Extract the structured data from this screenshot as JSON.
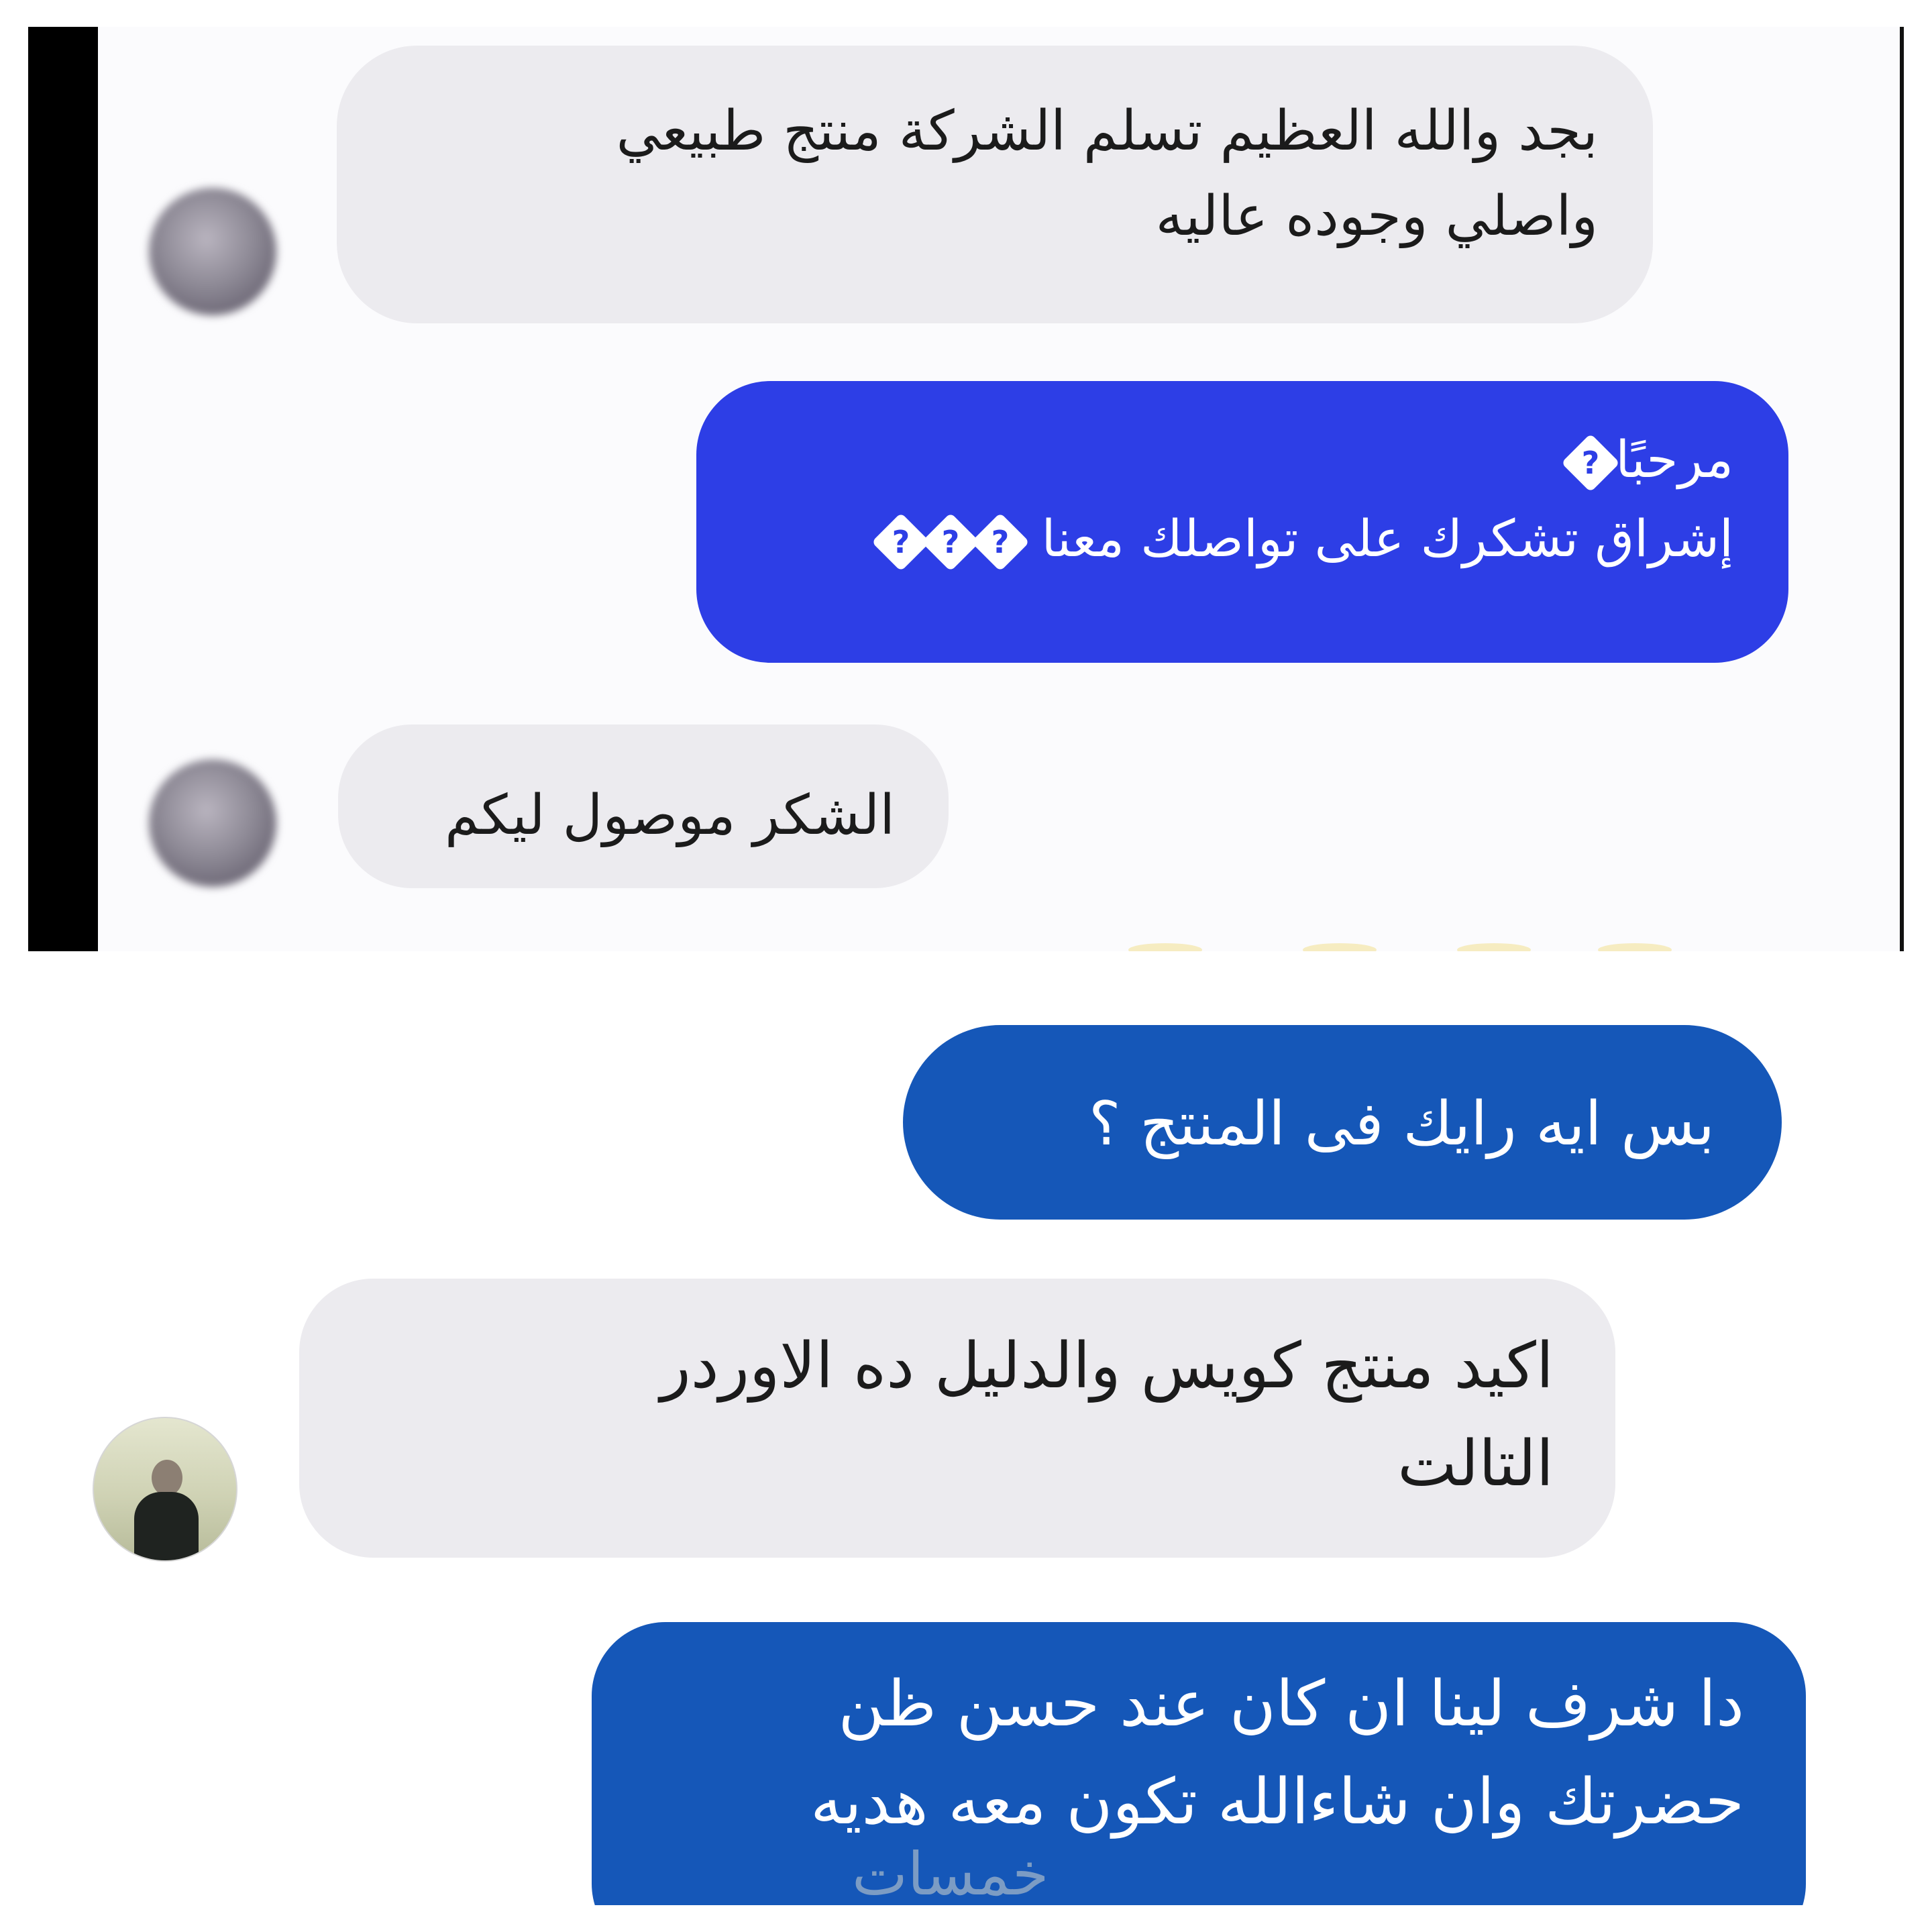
{
  "top_panel": {
    "messages": [
      {
        "lines": [
          "بجد والله العظيم تسلم الشركة منتج طبيعي",
          "واصلي وجوده عاليه"
        ]
      },
      {
        "line1": "مرحبًا",
        "line2": "إشراق تشكرك على تواصلك معنا"
      },
      {
        "lines": [
          "الشكر موصول ليكم"
        ]
      }
    ]
  },
  "bottom_panel": {
    "messages": [
      {
        "lines": [
          "بس ايه رايك فى المنتج ؟"
        ]
      },
      {
        "lines": [
          "اكيد منتج كويس والدليل  ده الاوردر",
          "التالت"
        ]
      },
      {
        "lines": [
          "دا شرف لينا ان كان عند حسن ظن",
          "حضرتك وان شاءالله تكون معه هديه"
        ]
      }
    ]
  },
  "watermark": "خمسات",
  "colors": {
    "incoming_bubble": "#ecebef",
    "outgoing_bubble_top": "#2d3ee6",
    "outgoing_bubble_bottom": "#1557b8"
  }
}
